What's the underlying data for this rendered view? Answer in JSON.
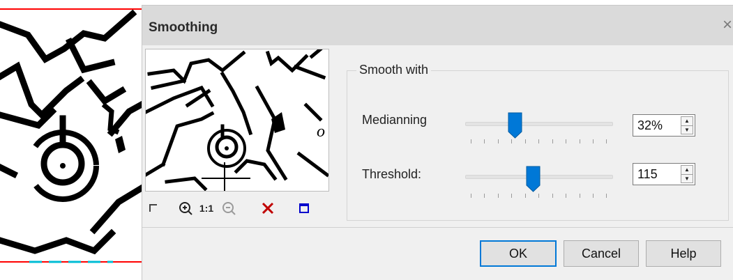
{
  "dialog": {
    "title": "Smoothing",
    "close_glyph": "×"
  },
  "preview_toolbar": {
    "zoom_in_icon": "zoom-in-icon",
    "actual_size_label": "1:1",
    "zoom_out_icon": "zoom-out-icon",
    "delete_icon": "delete-icon",
    "frame_icon": "frame-icon"
  },
  "group": {
    "legend": "Smooth with",
    "mediaanning": {
      "label": "Medianning",
      "value": "32%",
      "level": 0.32
    },
    "threshold": {
      "label": "Threshold:",
      "value": "115",
      "level": 0.45
    }
  },
  "buttons": {
    "ok": "OK",
    "cancel": "Cancel",
    "help": "Help"
  },
  "colors": {
    "accent": "#0078d7",
    "delete": "#c00000",
    "frame": "#0000cc",
    "guide_line": "#ff0000",
    "guide_dash": "#00bcd4"
  }
}
